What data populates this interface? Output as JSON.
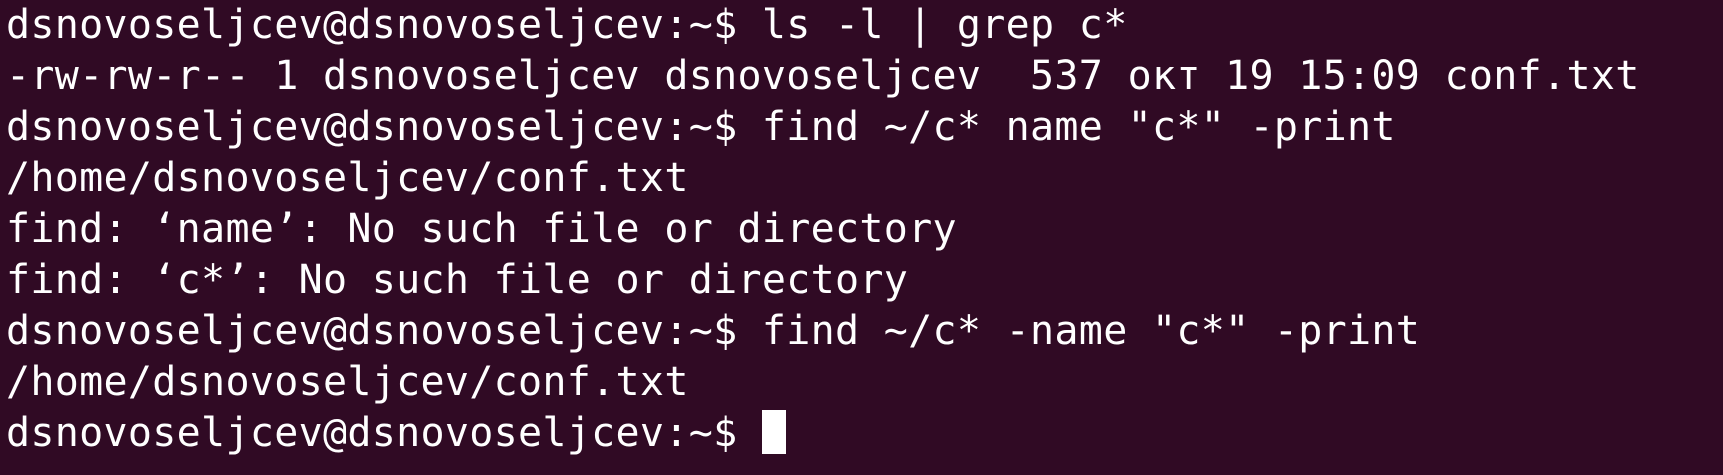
{
  "terminal": {
    "background": "#300a24",
    "foreground": "#ffffff",
    "lines": [
      "dsnovoseljcev@dsnovoseljcev:~$ ls -l | grep c*",
      "-rw-rw-r-- 1 dsnovoseljcev dsnovoseljcev  537 окт 19 15:09 conf.txt",
      "dsnovoseljcev@dsnovoseljcev:~$ find ~/c* name \"c*\" -print",
      "/home/dsnovoseljcev/conf.txt",
      "find: ‘name’: No such file or directory",
      "find: ‘c*’: No such file or directory",
      "dsnovoseljcev@dsnovoseljcev:~$ find ~/c* -name \"c*\" -print",
      "/home/dsnovoseljcev/conf.txt"
    ],
    "prompt": "dsnovoseljcev@dsnovoseljcev:~$ "
  }
}
